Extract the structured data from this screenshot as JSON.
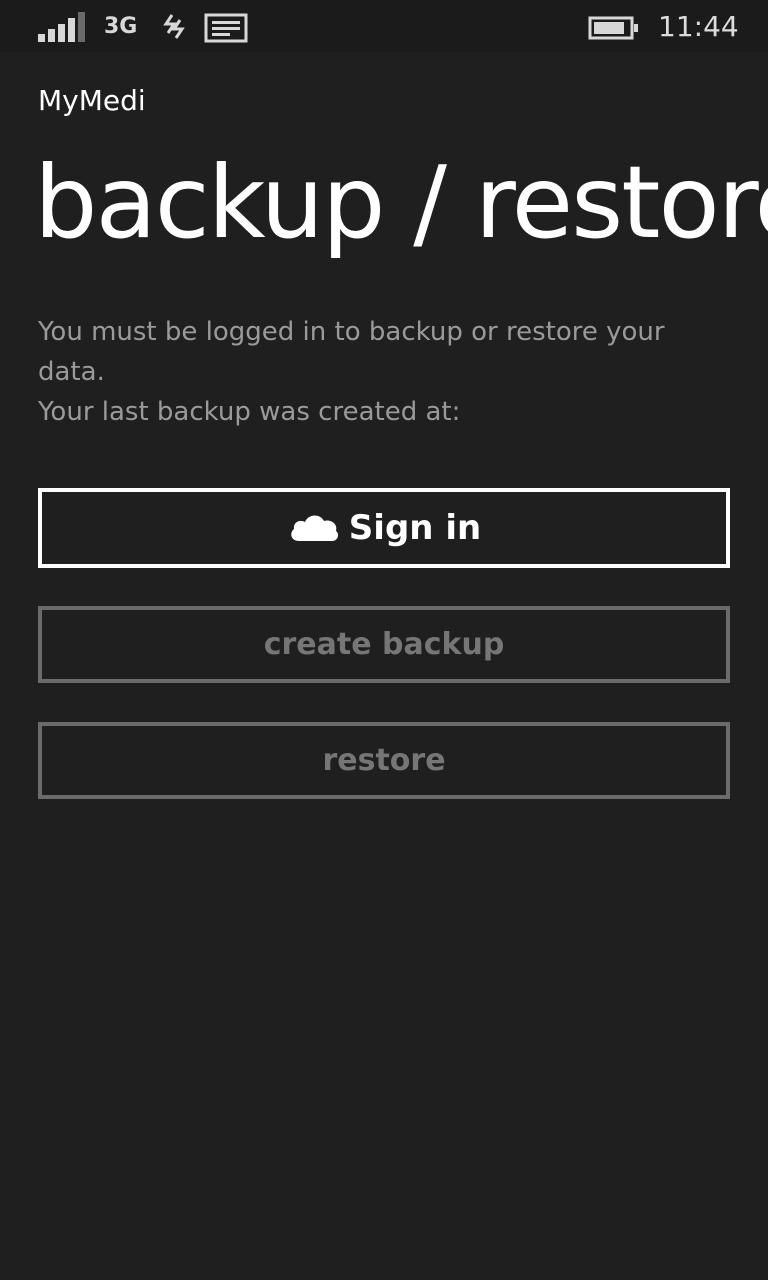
{
  "status_bar": {
    "network": "3G",
    "time": "11:44",
    "signal_icon": "signal-strength-icon",
    "data_icon": "data-transfer-icon",
    "message_icon": "message-icon",
    "battery_icon": "battery-icon"
  },
  "header": {
    "app_name": "MyMedi",
    "title": "backup / restore"
  },
  "info": {
    "line1": "You must be logged in to backup or restore your data.",
    "line2": "Your last backup was created at:"
  },
  "buttons": {
    "sign_in": "Sign in",
    "sign_in_icon": "cloud-icon",
    "create_backup": "create backup",
    "restore": "restore"
  },
  "colors": {
    "background": "#1f1f1f",
    "text": "#ffffff",
    "muted_text": "#9a9a9a",
    "disabled": "#6b6b6b"
  }
}
